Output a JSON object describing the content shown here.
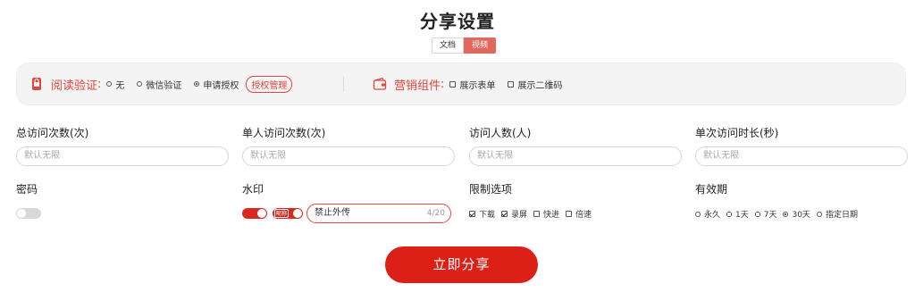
{
  "page": {
    "title": "分享设置"
  },
  "tabs": [
    {
      "label": "文档",
      "active": false
    },
    {
      "label": "视频",
      "active": true
    }
  ],
  "options_bar": {
    "read_verify": {
      "title": "阅读验证",
      "colon": ":",
      "options": [
        {
          "label": "无",
          "checked": false
        },
        {
          "label": "微信验证",
          "checked": false
        },
        {
          "label": "申请授权",
          "checked": true
        }
      ],
      "manage_link": "授权管理"
    },
    "marketing": {
      "title": "营销组件",
      "colon": ":",
      "options": [
        {
          "label": "展示表单",
          "checked": false
        },
        {
          "label": "展示二维码",
          "checked": false
        }
      ]
    }
  },
  "fields": {
    "total_visits": {
      "label": "总访问次数(次)",
      "placeholder": "默认无限"
    },
    "single_visits": {
      "label": "单人访问次数(次)",
      "placeholder": "默认无限"
    },
    "visitor_count": {
      "label": "访问人数(人)",
      "placeholder": "默认无限"
    },
    "single_duration": {
      "label": "单次访问时长(秒)",
      "placeholder": "默认无限"
    },
    "password": {
      "label": "密码",
      "enabled": false
    },
    "watermark": {
      "label": "水印",
      "enabled": true,
      "nickname_tag": "昵称",
      "nickname_enabled": true,
      "text": "禁止外传",
      "count": "4/20"
    },
    "limits": {
      "label": "限制选项",
      "options": [
        {
          "label": "下载",
          "checked": true
        },
        {
          "label": "录屏",
          "checked": true
        },
        {
          "label": "快进",
          "checked": false
        },
        {
          "label": "倍速",
          "checked": false
        }
      ]
    },
    "validity": {
      "label": "有效期",
      "options": [
        {
          "label": "永久",
          "checked": false
        },
        {
          "label": "1天",
          "checked": false
        },
        {
          "label": "7天",
          "checked": false
        },
        {
          "label": "30天",
          "checked": true
        },
        {
          "label": "指定日期",
          "checked": false
        }
      ]
    }
  },
  "submit": {
    "label": "立即分享"
  },
  "colors": {
    "accent": "#dc1f17",
    "accent_light": "#e0473d",
    "tab_active": "#e0685e"
  }
}
